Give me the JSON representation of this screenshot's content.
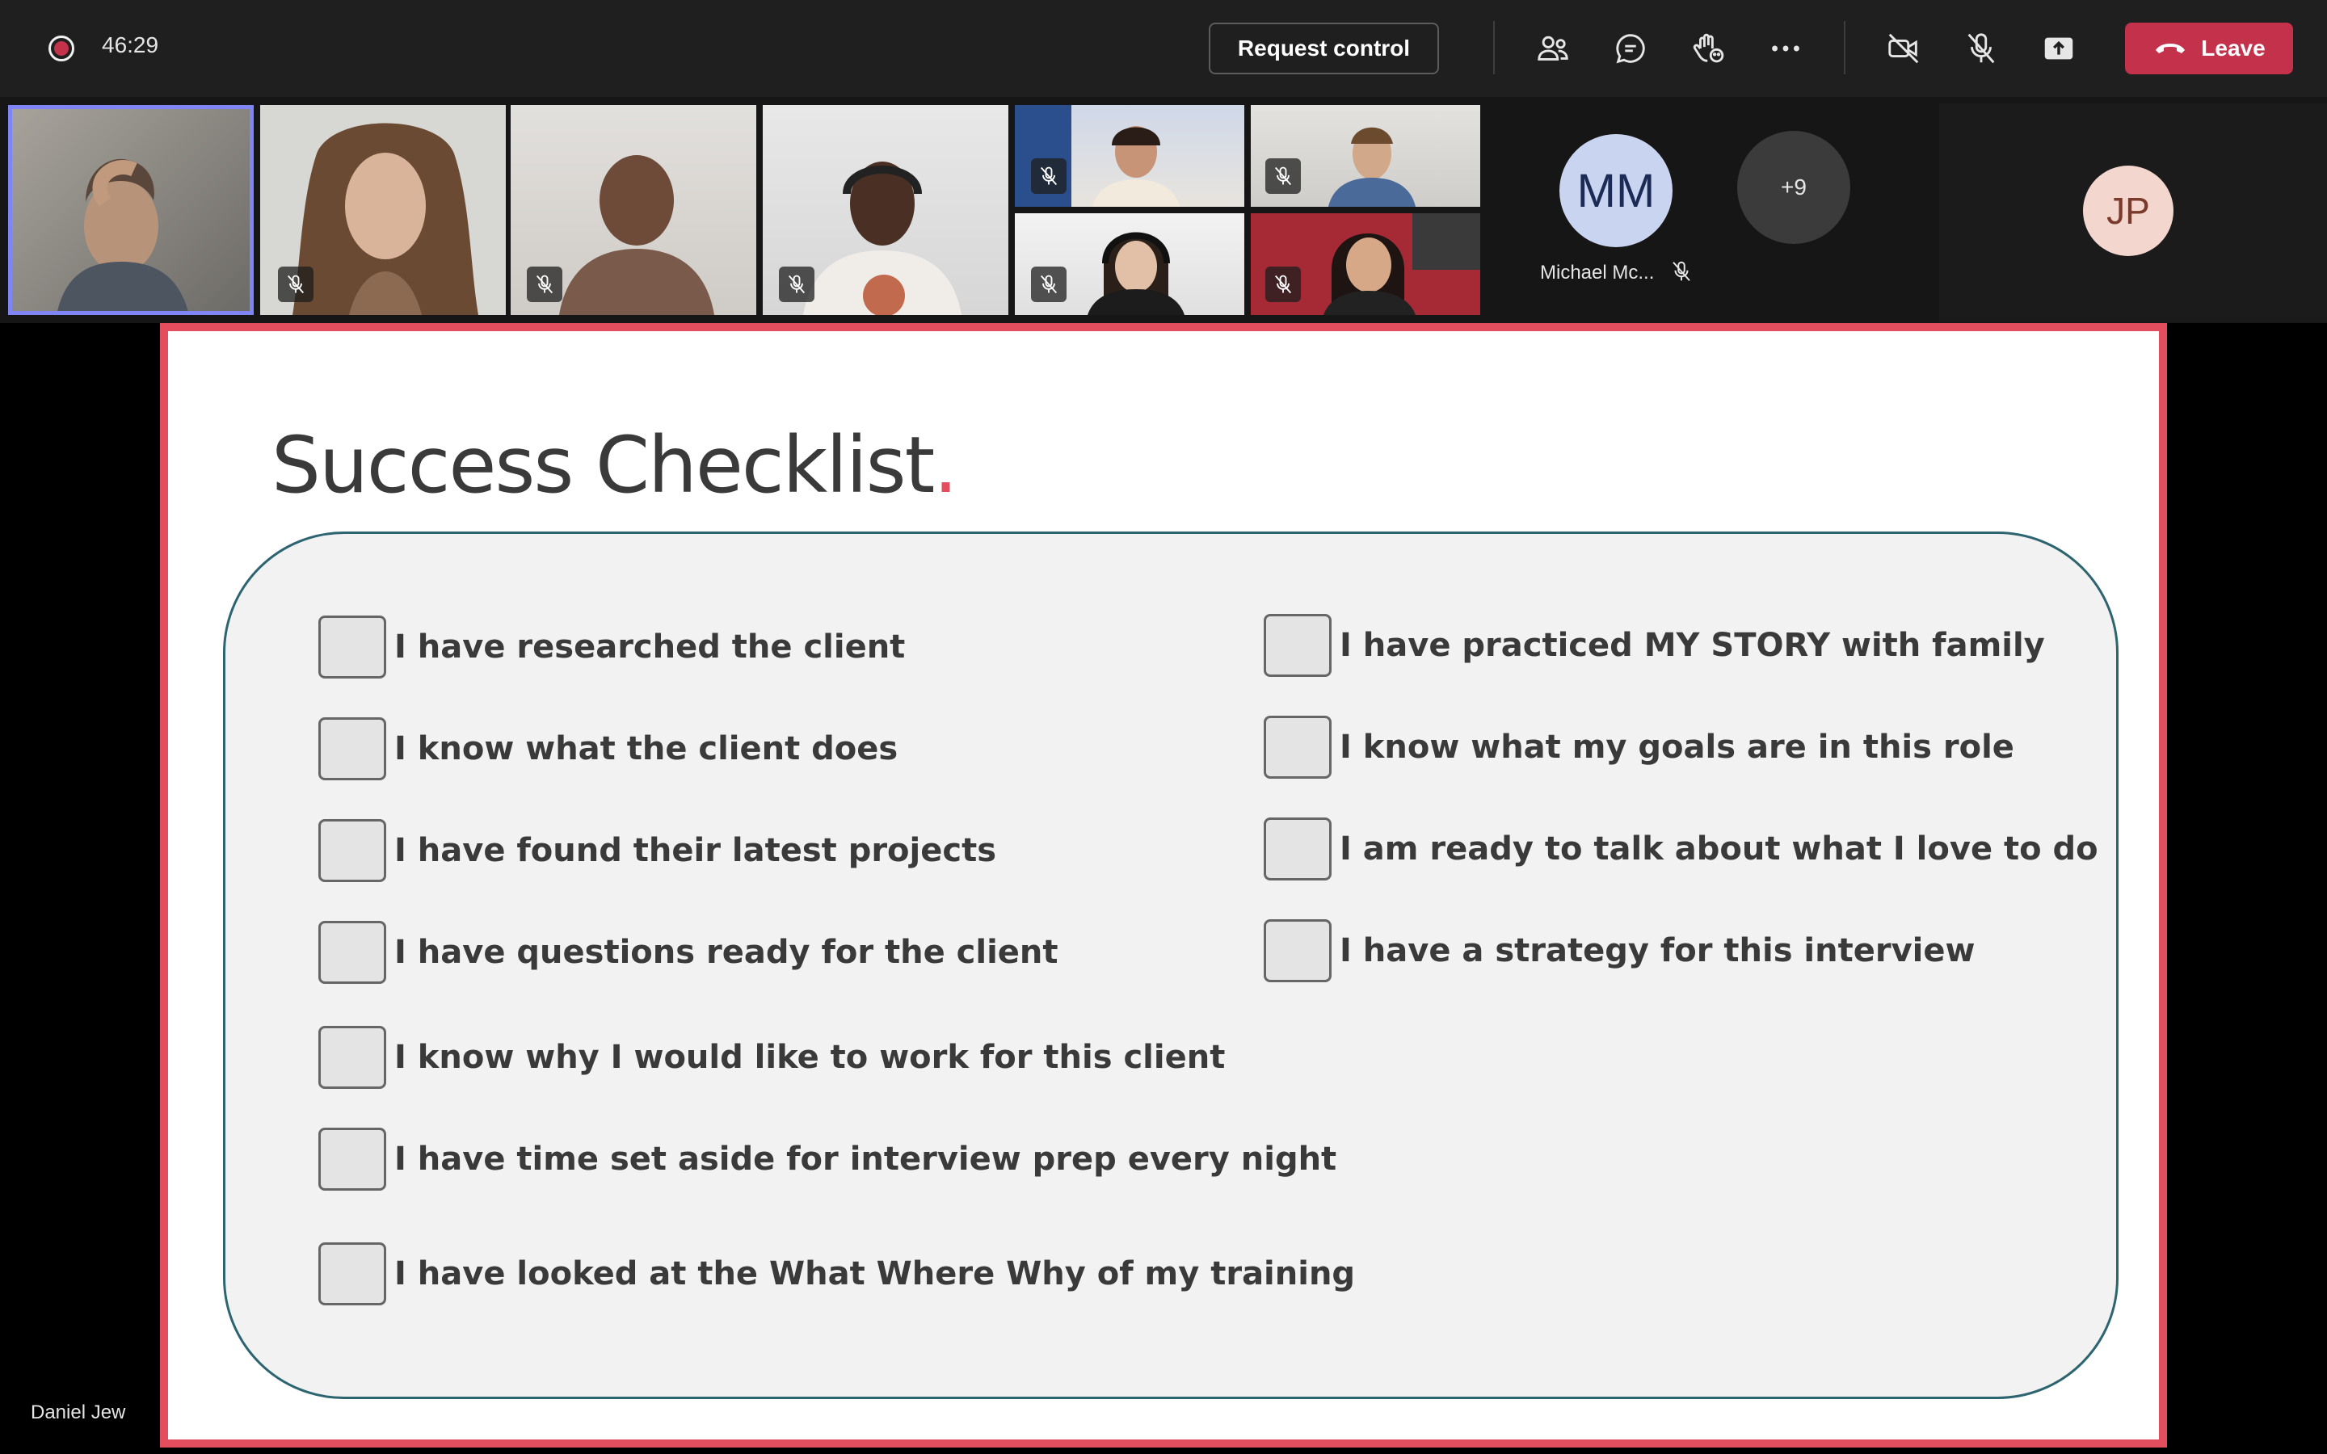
{
  "toolbar": {
    "timer": "46:29",
    "request_control": "Request control",
    "leave": "Leave",
    "icons": [
      "participants-icon",
      "chat-icon",
      "reactions-icon",
      "more-icon",
      "camera-off-icon",
      "mic-off-icon",
      "share-icon"
    ]
  },
  "participants": {
    "mm_initials": "MM",
    "mm_name": "Michael Mc...",
    "overflow": "+9",
    "jp_initials": "JP"
  },
  "slide": {
    "title": "Success Checklist",
    "title_dot": ".",
    "left_items": [
      "I have researched the client",
      "I know what the client does",
      "I have found their latest projects",
      "I have questions ready for the client",
      "I know why I would like to work for this client",
      "I have time set aside for interview prep every night",
      "I have looked at the What Where Why of my training"
    ],
    "right_items": [
      "I have practiced MY STORY with family",
      "I know what my goals are in this role",
      "I am ready to talk about what I love to do",
      "I have a strategy for this interview"
    ]
  },
  "presenter": {
    "name": "Daniel Jew"
  },
  "colors": {
    "accent": "#e24e5e",
    "leave": "#c4314b",
    "active_speaker": "#7f85f5",
    "panel_border": "#2c6470"
  }
}
